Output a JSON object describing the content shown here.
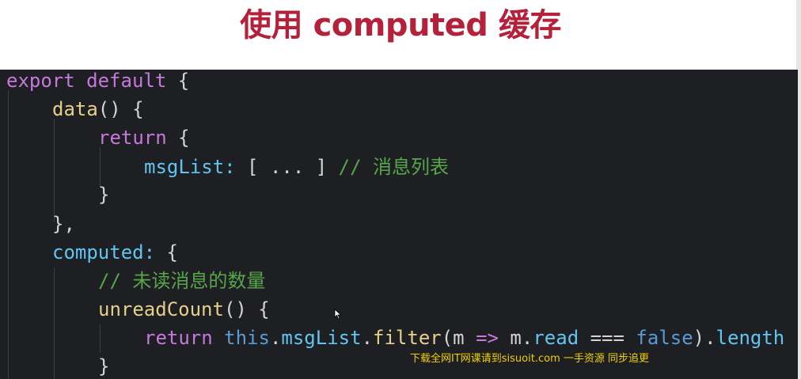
{
  "slide": {
    "title": "使用 computed 缓存"
  },
  "code": {
    "l1": {
      "kw": "export default",
      "p": " {"
    },
    "l2": {
      "fn": "data",
      "p": "() {"
    },
    "l3": {
      "kw": "return",
      "p": " {"
    },
    "l4": {
      "prop": "msgList:",
      "p": " [ ... ] ",
      "cm": "// 消息列表"
    },
    "l5": {
      "p": "}"
    },
    "l6": {
      "p": "},"
    },
    "l7": {
      "prop": "computed:",
      "p": " {"
    },
    "l8": {
      "cm": "// 未读消息的数量"
    },
    "l9": {
      "fn": "unreadCount",
      "p": "() {"
    },
    "l10": {
      "kw": "return",
      "this": "this",
      "dot1": ".",
      "prop1": "msgList",
      "dot2": ".",
      "fn": "filter",
      "p1": "(m ",
      "arrow": "=>",
      "p2": " m.",
      "prop2": "read",
      "eq": " === ",
      "bool": "false",
      "p3": ").",
      "prop3": "length"
    },
    "l11": {
      "p": "}"
    }
  },
  "watermark": {
    "text": "下载全网IT网课请到sisuoit.com 一手资源 同步追更"
  },
  "colors": {
    "title": "#b5203a",
    "keyword": "#c678dd",
    "function": "#e5d08b",
    "property": "#61c5f2",
    "comment": "#57a64a",
    "background": "#1e1f22"
  }
}
